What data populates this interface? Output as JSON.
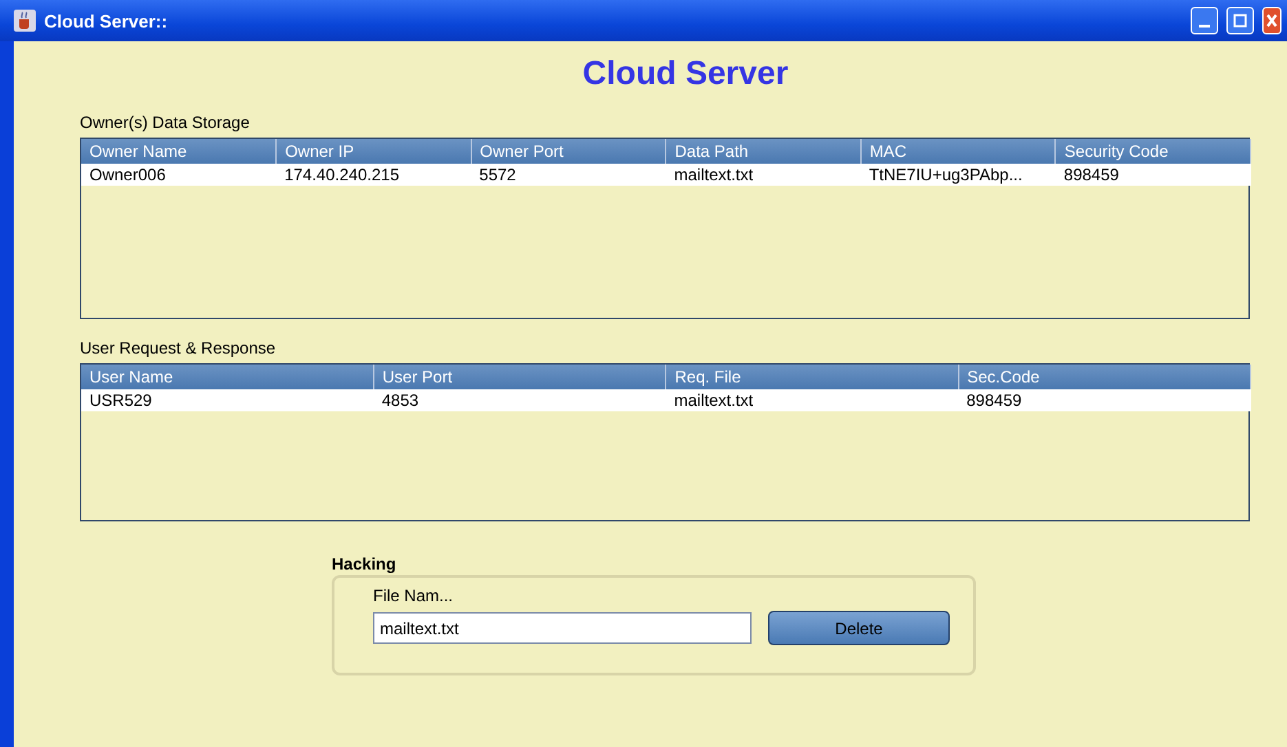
{
  "window": {
    "title": "Cloud Server::"
  },
  "heading": "Cloud Server",
  "owner_table": {
    "label": "Owner(s) Data Storage",
    "columns": [
      "Owner Name",
      "Owner IP",
      "Owner Port",
      "Data Path",
      "MAC",
      "Security Code"
    ],
    "rows": [
      [
        "Owner006",
        "174.40.240.215",
        "5572",
        "mailtext.txt",
        "TtNE7IU+ug3PAbp...",
        "898459"
      ]
    ]
  },
  "user_table": {
    "label": "User Request & Response",
    "columns": [
      "User Name",
      "User Port",
      "Req. File",
      "Sec.Code"
    ],
    "rows": [
      [
        "USR529",
        "4853",
        "mailtext.txt",
        "898459"
      ]
    ]
  },
  "hacking": {
    "label": "Hacking",
    "field_label": "File Nam...",
    "file_name": "mailtext.txt",
    "button": "Delete"
  }
}
